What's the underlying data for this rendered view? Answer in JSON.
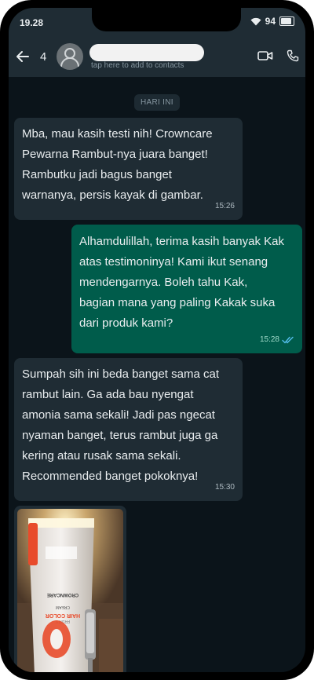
{
  "status_bar": {
    "time": "19.28",
    "battery": "94"
  },
  "header": {
    "unread_count": "4",
    "contact_hint": "tap here to add to contacts"
  },
  "chat": {
    "day_divider": "HARI INI",
    "messages": [
      {
        "direction": "incoming",
        "text": "Mba, mau kasih testi nih! Crowncare\nPewarna Rambut-nya juara banget!\nRambutku jadi bagus banget\nwarnanya, persis kayak di gambar.",
        "time": "15:26"
      },
      {
        "direction": "outgoing",
        "text": "Alhamdulillah, terima kasih banyak Kak\natas testimoninya! Kami ikut senang\nmendengarnya. Boleh tahu Kak,\nbagian mana yang paling Kakak suka\ndari produk kami?",
        "time": "15:28",
        "status": "read"
      },
      {
        "direction": "incoming",
        "text": "Sumpah sih ini beda banget sama cat\nrambut lain. Ga ada bau nyengat\namonia sama sekali! Jadi pas ngecat\nnyaman banget, terus rambut juga ga\nkering atau rusak sama sekali.\nRecommended banget pokoknya!",
        "time": "15:30"
      }
    ],
    "image_message": {
      "product_labels": [
        "CROWNCARE",
        "HAIR COLOR",
        "CREAM",
        "FRUITY"
      ]
    }
  },
  "colors": {
    "chat_bg": "#0b141a",
    "incoming": "#1f2c34",
    "outgoing": "#005c4b",
    "tick_read": "#53bdeb"
  }
}
